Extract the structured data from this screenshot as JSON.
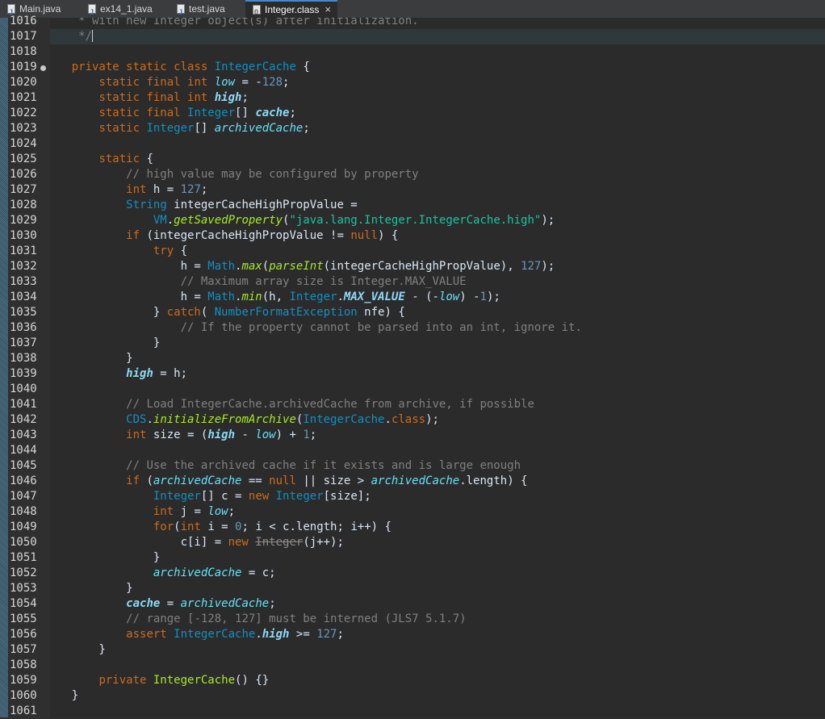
{
  "tabs": [
    {
      "label": "Main.java",
      "icon": "java-file-icon",
      "active": false
    },
    {
      "label": "ex14_1.java",
      "icon": "java-file-icon",
      "active": false
    },
    {
      "label": "test.java",
      "icon": "java-file-icon",
      "active": false
    },
    {
      "label": "Integer.class",
      "icon": "class-file-icon",
      "active": true
    }
  ],
  "tab_close_glyph": "×",
  "line_numbers": [
    "1016",
    "1017",
    "1018",
    "1019",
    "1020",
    "1021",
    "1022",
    "1023",
    "1024",
    "1025",
    "1026",
    "1027",
    "1028",
    "1029",
    "1030",
    "1031",
    "1032",
    "1033",
    "1034",
    "1035",
    "1036",
    "1037",
    "1038",
    "1039",
    "1040",
    "1041",
    "1042",
    "1043",
    "1044",
    "1045",
    "1046",
    "1047",
    "1048",
    "1049",
    "1050",
    "1051",
    "1052",
    "1053",
    "1054",
    "1055",
    "1056",
    "1057",
    "1058",
    "1059",
    "1060",
    "1061"
  ],
  "code_lines": [
    [
      [
        "c",
        "     * with new Integer object(s) after initialization."
      ]
    ],
    [
      [
        "c",
        "     */"
      ],
      [
        "caret",
        ""
      ]
    ],
    [],
    [
      [
        "p",
        "    "
      ],
      [
        "k",
        "private static class "
      ],
      [
        "t",
        "IntegerCache"
      ],
      [
        "p",
        " {"
      ]
    ],
    [
      [
        "p",
        "        "
      ],
      [
        "k",
        "static final int "
      ],
      [
        "f",
        "low"
      ],
      [
        "p",
        " = -"
      ],
      [
        "n",
        "128"
      ],
      [
        "p",
        ";"
      ]
    ],
    [
      [
        "p",
        "        "
      ],
      [
        "k",
        "static final int "
      ],
      [
        "fb",
        "high"
      ],
      [
        "p",
        ";"
      ]
    ],
    [
      [
        "p",
        "        "
      ],
      [
        "k",
        "static final "
      ],
      [
        "t",
        "Integer"
      ],
      [
        "p",
        "[] "
      ],
      [
        "fb",
        "cache"
      ],
      [
        "p",
        ";"
      ]
    ],
    [
      [
        "p",
        "        "
      ],
      [
        "k",
        "static "
      ],
      [
        "t",
        "Integer"
      ],
      [
        "p",
        "[] "
      ],
      [
        "f",
        "archivedCache"
      ],
      [
        "p",
        ";"
      ]
    ],
    [],
    [
      [
        "p",
        "        "
      ],
      [
        "k",
        "static"
      ],
      [
        "p",
        " {"
      ]
    ],
    [
      [
        "p",
        "            "
      ],
      [
        "c",
        "// high value may be configured by property"
      ]
    ],
    [
      [
        "p",
        "            "
      ],
      [
        "k",
        "int"
      ],
      [
        "p",
        " h = "
      ],
      [
        "n",
        "127"
      ],
      [
        "p",
        ";"
      ]
    ],
    [
      [
        "p",
        "            "
      ],
      [
        "t",
        "String"
      ],
      [
        "p",
        " integerCacheHighPropValue ="
      ]
    ],
    [
      [
        "p",
        "                "
      ],
      [
        "t",
        "VM"
      ],
      [
        "p",
        "."
      ],
      [
        "m",
        "getSavedProperty"
      ],
      [
        "p",
        "("
      ],
      [
        "s",
        "\"java.lang.Integer.IntegerCache.high\""
      ],
      [
        "p",
        ");"
      ]
    ],
    [
      [
        "p",
        "            "
      ],
      [
        "k",
        "if"
      ],
      [
        "p",
        " (integerCacheHighPropValue != "
      ],
      [
        "k",
        "null"
      ],
      [
        "p",
        ") {"
      ]
    ],
    [
      [
        "p",
        "                "
      ],
      [
        "k",
        "try"
      ],
      [
        "p",
        " {"
      ]
    ],
    [
      [
        "p",
        "                    h = "
      ],
      [
        "t",
        "Math"
      ],
      [
        "p",
        "."
      ],
      [
        "m",
        "max"
      ],
      [
        "p",
        "("
      ],
      [
        "m",
        "parseInt"
      ],
      [
        "p",
        "(integerCacheHighPropValue), "
      ],
      [
        "n",
        "127"
      ],
      [
        "p",
        ");"
      ]
    ],
    [
      [
        "p",
        "                    "
      ],
      [
        "c",
        "// Maximum array size is Integer.MAX_VALUE"
      ]
    ],
    [
      [
        "p",
        "                    h = "
      ],
      [
        "t",
        "Math"
      ],
      [
        "p",
        "."
      ],
      [
        "m",
        "min"
      ],
      [
        "p",
        "(h, "
      ],
      [
        "t",
        "Integer"
      ],
      [
        "p",
        "."
      ],
      [
        "fb",
        "MAX_VALUE"
      ],
      [
        "p",
        " - (-"
      ],
      [
        "f",
        "low"
      ],
      [
        "p",
        ") -"
      ],
      [
        "n",
        "1"
      ],
      [
        "p",
        ");"
      ]
    ],
    [
      [
        "p",
        "                } "
      ],
      [
        "k",
        "catch"
      ],
      [
        "p",
        "( "
      ],
      [
        "t",
        "NumberFormatException"
      ],
      [
        "p",
        " nfe) {"
      ]
    ],
    [
      [
        "p",
        "                    "
      ],
      [
        "c",
        "// If the property cannot be parsed into an int, ignore it."
      ]
    ],
    [
      [
        "p",
        "                }"
      ]
    ],
    [
      [
        "p",
        "            }"
      ]
    ],
    [
      [
        "p",
        "            "
      ],
      [
        "fb",
        "high"
      ],
      [
        "p",
        " = h;"
      ]
    ],
    [],
    [
      [
        "p",
        "            "
      ],
      [
        "c",
        "// Load IntegerCache.archivedCache from archive, if possible"
      ]
    ],
    [
      [
        "p",
        "            "
      ],
      [
        "t",
        "CDS"
      ],
      [
        "p",
        "."
      ],
      [
        "m",
        "initializeFromArchive"
      ],
      [
        "p",
        "("
      ],
      [
        "t",
        "IntegerCache"
      ],
      [
        "p",
        "."
      ],
      [
        "k",
        "class"
      ],
      [
        "p",
        ");"
      ]
    ],
    [
      [
        "p",
        "            "
      ],
      [
        "k",
        "int"
      ],
      [
        "p",
        " size = ("
      ],
      [
        "fb",
        "high"
      ],
      [
        "p",
        " - "
      ],
      [
        "f",
        "low"
      ],
      [
        "p",
        ") + "
      ],
      [
        "n",
        "1"
      ],
      [
        "p",
        ";"
      ]
    ],
    [],
    [
      [
        "p",
        "            "
      ],
      [
        "c",
        "// Use the archived cache if it exists and is large enough"
      ]
    ],
    [
      [
        "p",
        "            "
      ],
      [
        "k",
        "if"
      ],
      [
        "p",
        " ("
      ],
      [
        "f",
        "archivedCache"
      ],
      [
        "p",
        " == "
      ],
      [
        "k",
        "null"
      ],
      [
        "p",
        " || size > "
      ],
      [
        "f",
        "archivedCache"
      ],
      [
        "p",
        ".length) {"
      ]
    ],
    [
      [
        "p",
        "                "
      ],
      [
        "t",
        "Integer"
      ],
      [
        "p",
        "[] c = "
      ],
      [
        "k",
        "new "
      ],
      [
        "t",
        "Integer"
      ],
      [
        "p",
        "[size];"
      ]
    ],
    [
      [
        "p",
        "                "
      ],
      [
        "k",
        "int"
      ],
      [
        "p",
        " j = "
      ],
      [
        "f",
        "low"
      ],
      [
        "p",
        ";"
      ]
    ],
    [
      [
        "p",
        "                "
      ],
      [
        "k",
        "for"
      ],
      [
        "p",
        "("
      ],
      [
        "k",
        "int"
      ],
      [
        "p",
        " i = "
      ],
      [
        "n",
        "0"
      ],
      [
        "p",
        "; i < c.length; i++) {"
      ]
    ],
    [
      [
        "p",
        "                    c[i] = "
      ],
      [
        "k",
        "new "
      ],
      [
        "d",
        "Integer"
      ],
      [
        "p",
        "(j++);"
      ]
    ],
    [
      [
        "p",
        "                }"
      ]
    ],
    [
      [
        "p",
        "                "
      ],
      [
        "f",
        "archivedCache"
      ],
      [
        "p",
        " = c;"
      ]
    ],
    [
      [
        "p",
        "            }"
      ]
    ],
    [
      [
        "p",
        "            "
      ],
      [
        "fb",
        "cache"
      ],
      [
        "p",
        " = "
      ],
      [
        "f",
        "archivedCache"
      ],
      [
        "p",
        ";"
      ]
    ],
    [
      [
        "p",
        "            "
      ],
      [
        "c",
        "// range [-128, 127] must be interned (JLS7 5.1.7)"
      ]
    ],
    [
      [
        "p",
        "            "
      ],
      [
        "k",
        "assert "
      ],
      [
        "t",
        "IntegerCache"
      ],
      [
        "p",
        "."
      ],
      [
        "fb",
        "high"
      ],
      [
        "p",
        " >= "
      ],
      [
        "n",
        "127"
      ],
      [
        "p",
        ";"
      ]
    ],
    [
      [
        "p",
        "        }"
      ]
    ],
    [],
    [
      [
        "p",
        "        "
      ],
      [
        "k",
        "private "
      ],
      [
        "md",
        "IntegerCache"
      ],
      [
        "p",
        "() {}"
      ]
    ],
    [
      [
        "p",
        "    }"
      ]
    ],
    []
  ]
}
